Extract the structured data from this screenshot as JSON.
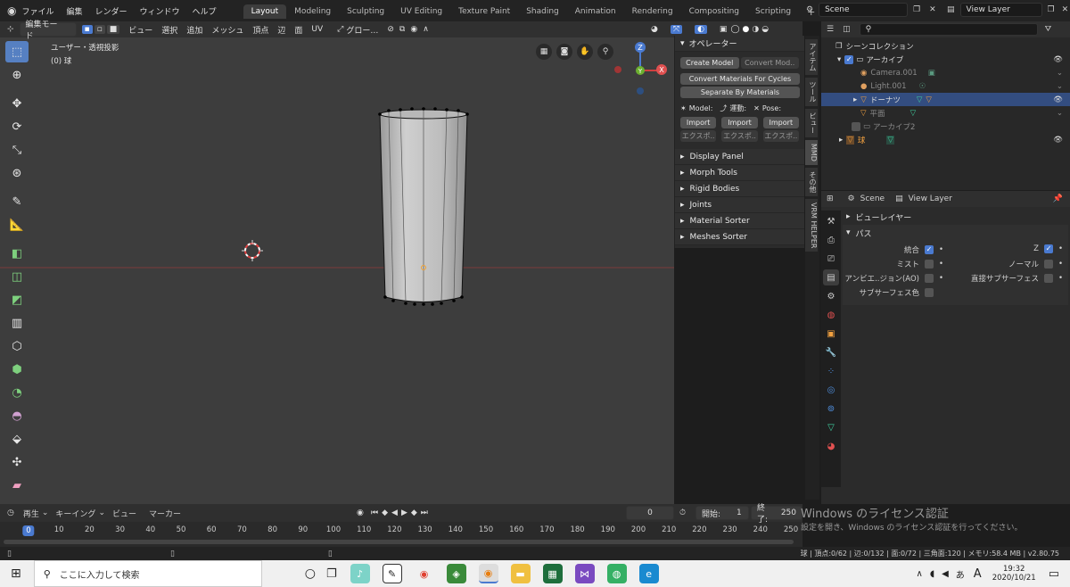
{
  "topbar": {
    "menus": [
      "ファイル",
      "編集",
      "レンダー",
      "ウィンドウ",
      "ヘルプ"
    ],
    "workspace_tabs": [
      "Layout",
      "Modeling",
      "Sculpting",
      "UV Editing",
      "Texture Paint",
      "Shading",
      "Animation",
      "Rendering",
      "Compositing",
      "Scripting"
    ],
    "active_tab": "Layout",
    "add_tab": "+",
    "scene": "Scene",
    "view_layer": "View Layer"
  },
  "viewport_header": {
    "mode": "編集モード",
    "menus": [
      "ビュー",
      "選択",
      "追加",
      "メッシュ",
      "頂点",
      "辺",
      "面",
      "UV"
    ],
    "transform_orientation": "グロー…"
  },
  "viewport": {
    "view_label": "ユーザー・透視投影",
    "object_label": "(0) 球",
    "gizmo": {
      "z": "Z",
      "x": "X",
      "y": "Y"
    }
  },
  "npanel": {
    "operator_title": "オペレーター",
    "create_model": "Create Model",
    "convert_model": "Convert Mod..",
    "convert_materials": "Convert Materials For Cycles",
    "separate_by_materials": "Separate By Materials",
    "model_label": "Model:",
    "motion_label": "運動:",
    "pose_label": "Pose:",
    "import": "Import",
    "export": "エクスポ..",
    "sections": [
      "Display Panel",
      "Morph Tools",
      "Rigid Bodies",
      "Joints",
      "Material Sorter",
      "Meshes Sorter"
    ]
  },
  "vertical_tabs": [
    "アイテム",
    "ツール",
    "ビュー",
    "MMD",
    "その他",
    "VRM HELPER"
  ],
  "outliner": {
    "search_placeholder": "",
    "root": "シーンコレクション",
    "rows": [
      {
        "label": "アーカイブ",
        "indent": 1,
        "selected": false,
        "dim": false
      },
      {
        "label": "Camera.001",
        "indent": 2,
        "selected": false,
        "dim": true
      },
      {
        "label": "Light.001",
        "indent": 2,
        "selected": false,
        "dim": true
      },
      {
        "label": "ドーナツ",
        "indent": 2,
        "selected": true,
        "dim": false
      },
      {
        "label": "平面",
        "indent": 2,
        "selected": false,
        "dim": true
      },
      {
        "label": "アーカイブ2",
        "indent": 1,
        "selected": false,
        "dim": true
      },
      {
        "label": "球",
        "indent": 1,
        "selected": false,
        "dim": false
      }
    ]
  },
  "properties": {
    "scene": "Scene",
    "view_layer": "View Layer",
    "section_view_layer": "ビューレイヤー",
    "section_passes": "パス",
    "items_left": [
      {
        "label": "統合",
        "checked": true
      },
      {
        "label": "ミスト",
        "checked": false
      },
      {
        "label": "アンビエ..ジョン(AO)",
        "checked": false
      },
      {
        "label": "サブサーフェス色",
        "checked": false
      }
    ],
    "items_right": [
      {
        "label": "Z",
        "checked": true
      },
      {
        "label": "ノーマル",
        "checked": false
      },
      {
        "label": "直接サブサーフェス",
        "checked": false
      }
    ]
  },
  "timeline": {
    "play_menu": "再生",
    "keying_menu": "キーイング",
    "view_menu": "ビュー",
    "marker_menu": "マーカー",
    "current_frame": "0",
    "start_label": "開始:",
    "start": "1",
    "end_label": "終了:",
    "end": "250",
    "ticks": [
      "0",
      "10",
      "20",
      "30",
      "40",
      "50",
      "60",
      "70",
      "80",
      "90",
      "100",
      "110",
      "120",
      "130",
      "140",
      "150",
      "160",
      "170",
      "180",
      "190",
      "200",
      "210",
      "220",
      "230",
      "240",
      "250"
    ]
  },
  "watermark": {
    "line1": "Windows のライセンス認証",
    "line2": "設定を開き、Windows のライセンス認証を行ってください。"
  },
  "statusbar": {
    "text": "球 | 頂点:0/62 | 辺:0/132 | 面:0/72 | 三角面:120 | メモリ:58.4 MB | v2.80.75"
  },
  "taskbar": {
    "search": "ここに入力して検索",
    "time": "19:32",
    "date": "2020/10/21",
    "ime": "A"
  }
}
